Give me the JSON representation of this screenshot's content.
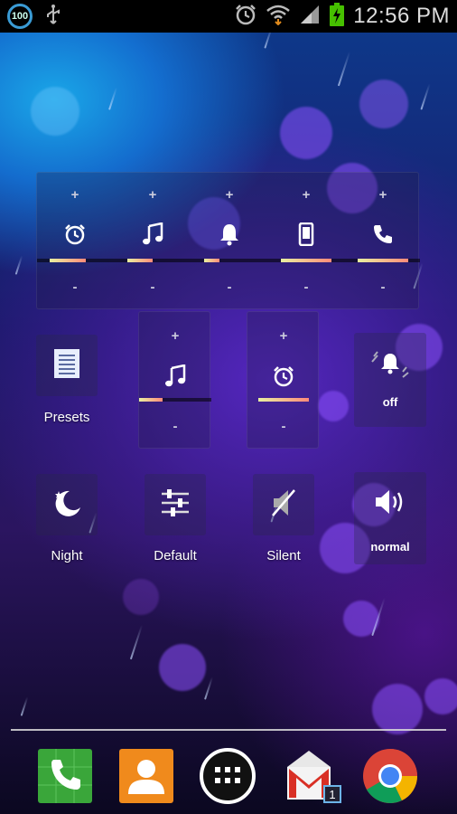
{
  "status_bar": {
    "battery_level": "100",
    "time": "12:56 PM",
    "icons": [
      "battery-circle-icon",
      "usb-icon",
      "alarm-icon",
      "wifi-icon",
      "signal-icon",
      "battery-charging-icon"
    ]
  },
  "volume_widget": {
    "columns": [
      {
        "name": "alarm",
        "plus": "+",
        "minus": "-",
        "icon": "alarm-icon",
        "level": 0.72
      },
      {
        "name": "music",
        "plus": "+",
        "minus": "-",
        "icon": "music-icon",
        "level": 0.5
      },
      {
        "name": "notification",
        "plus": "+",
        "minus": "-",
        "icon": "bell-icon",
        "level": 0.3
      },
      {
        "name": "system",
        "plus": "+",
        "minus": "-",
        "icon": "phone-device-icon",
        "level": 1.0
      },
      {
        "name": "call",
        "plus": "+",
        "minus": "-",
        "icon": "call-icon",
        "level": 1.0
      }
    ]
  },
  "shortcuts": {
    "presets": {
      "label": "Presets",
      "icon": "list-icon"
    },
    "music_mini": {
      "plus": "+",
      "minus": "-",
      "icon": "music-icon",
      "level": 0.33
    },
    "alarm_mini": {
      "plus": "+",
      "minus": "-",
      "icon": "alarm-icon",
      "level": 1.0
    },
    "vibrate": {
      "label": "off",
      "icon": "vibrate-bell-icon"
    },
    "night": {
      "label": "Night",
      "icon": "moon-icon"
    },
    "default": {
      "label": "Default",
      "icon": "sliders-icon"
    },
    "silent": {
      "label": "Silent",
      "icon": "speaker-muted-icon"
    },
    "ringer": {
      "label": "normal",
      "icon": "speaker-icon"
    }
  },
  "dock": {
    "items": [
      {
        "name": "phone",
        "icon": "phone-app-icon"
      },
      {
        "name": "contacts",
        "icon": "contacts-app-icon"
      },
      {
        "name": "app-drawer",
        "icon": "app-drawer-icon"
      },
      {
        "name": "gmail",
        "icon": "gmail-app-icon",
        "badge": "1"
      },
      {
        "name": "chrome",
        "icon": "chrome-app-icon"
      }
    ]
  },
  "colors": {
    "bar_fill": "#e8f0a0",
    "bar_fill_end": "#ff8a7a",
    "status_bar_bg": "#000000",
    "battery_ring": "#3a9bd5"
  }
}
